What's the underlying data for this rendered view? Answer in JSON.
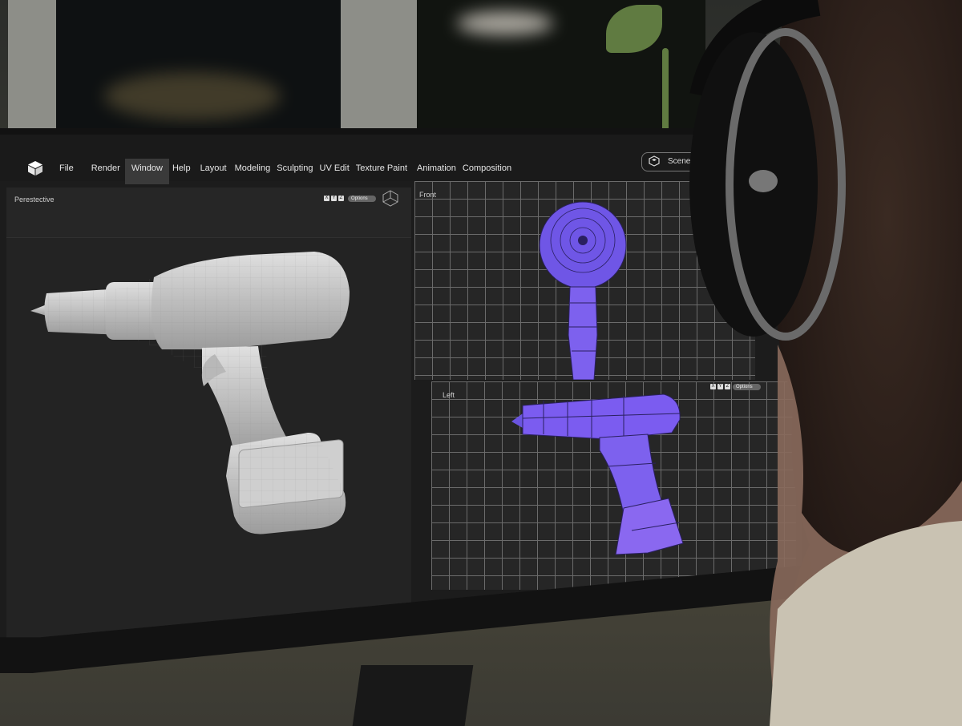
{
  "app": {
    "menu": [
      "File",
      "Render",
      "Window",
      "Help",
      "Layout",
      "Modeling",
      "Sculpting",
      "UV Edit",
      "Texture Paint",
      "Animation",
      "Composition"
    ],
    "active_menu": "Window",
    "scene_label": "Scene"
  },
  "viewports": {
    "perspective": {
      "title": "Perestective",
      "axes": [
        "X",
        "Y",
        "Z"
      ],
      "options": "Options"
    },
    "front": {
      "title": "Front"
    },
    "left": {
      "title": "Left",
      "axes": [
        "X",
        "Y",
        "Z"
      ],
      "options": "Options"
    }
  },
  "colors": {
    "wireframe": "#7b5cf0",
    "clay": "#c9c9c9",
    "grid": "#6b6b6b"
  }
}
